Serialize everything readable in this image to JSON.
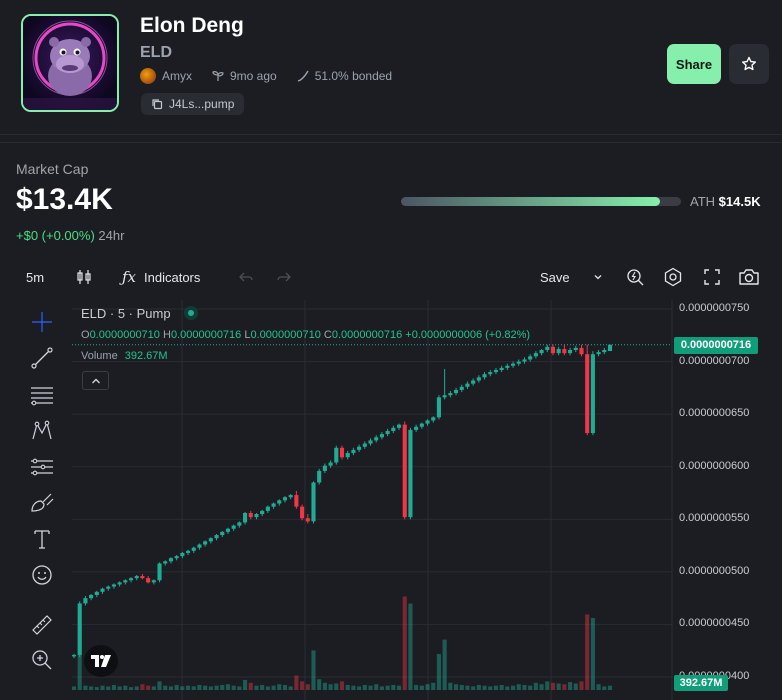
{
  "token": {
    "name": "Elon Deng",
    "ticker": "ELD",
    "creator": "Amyx",
    "age": "9mo ago",
    "bonded": "51.0% bonded",
    "contract_short": "J4Ls...pump"
  },
  "actions": {
    "share_label": "Share",
    "star_icon": "star-icon"
  },
  "market": {
    "label": "Market Cap",
    "value": "$13.4K",
    "change": "+$0 (+0.00%)",
    "period": "24hr",
    "ath_label": "ATH",
    "ath_value": "$14.5K",
    "ath_progress": 0.924
  },
  "toolbar": {
    "interval": "5m",
    "indicators_label": "Indicators",
    "save_label": "Save"
  },
  "chart_header": {
    "symbol": "ELD · 5 · Pump",
    "o_label": "O",
    "o": "0.0000000710",
    "h_label": "H",
    "h": "0.0000000716",
    "l_label": "L",
    "l": "0.0000000710",
    "c_label": "C",
    "c": "0.0000000716",
    "change": "+0.0000000006 (+0.82%)",
    "volume_label": "Volume",
    "volume": "392.67M"
  },
  "price_axis": [
    "0.0000000750",
    "0.0000000700",
    "0.0000000650",
    "0.0000000600",
    "0.0000000550",
    "0.0000000500",
    "0.0000000450",
    "0.0000000400"
  ],
  "last_price_tag": "0.0000000716",
  "volume_tag": "392.67M",
  "colors": {
    "up": "#22ab94",
    "down": "#f23645",
    "accent": "#86efac"
  },
  "chart_data": {
    "type": "candlestick",
    "ylim": [
      4e-08,
      7.6e-08
    ],
    "candles": [
      [
        4.2e-08,
        4.22e-08,
        4.18e-08,
        4.21e-08,
        "up"
      ],
      [
        4.21e-08,
        4.72e-08,
        4.19e-08,
        4.7e-08,
        "up"
      ],
      [
        4.7e-08,
        4.77e-08,
        4.68e-08,
        4.75e-08,
        "up"
      ],
      [
        4.75e-08,
        4.79e-08,
        4.73e-08,
        4.78e-08,
        "up"
      ],
      [
        4.78e-08,
        4.82e-08,
        4.76e-08,
        4.81e-08,
        "up"
      ],
      [
        4.81e-08,
        4.85e-08,
        4.79e-08,
        4.84e-08,
        "up"
      ],
      [
        4.84e-08,
        4.87e-08,
        4.82e-08,
        4.86e-08,
        "up"
      ],
      [
        4.86e-08,
        4.89e-08,
        4.84e-08,
        4.88e-08,
        "up"
      ],
      [
        4.88e-08,
        4.91e-08,
        4.86e-08,
        4.9e-08,
        "up"
      ],
      [
        4.9e-08,
        4.93e-08,
        4.88e-08,
        4.92e-08,
        "up"
      ],
      [
        4.92e-08,
        4.95e-08,
        4.9e-08,
        4.94e-08,
        "up"
      ],
      [
        4.94e-08,
        4.97e-08,
        4.92e-08,
        4.96e-08,
        "up"
      ],
      [
        4.96e-08,
        4.98e-08,
        4.93e-08,
        4.94e-08,
        "down"
      ],
      [
        4.94e-08,
        4.96e-08,
        4.89e-08,
        4.9e-08,
        "down"
      ],
      [
        4.9e-08,
        4.93e-08,
        4.88e-08,
        4.92e-08,
        "up"
      ],
      [
        4.92e-08,
        5.09e-08,
        4.9e-08,
        5.08e-08,
        "up"
      ],
      [
        5.08e-08,
        5.11e-08,
        5.06e-08,
        5.1e-08,
        "up"
      ],
      [
        5.1e-08,
        5.14e-08,
        5.08e-08,
        5.13e-08,
        "up"
      ],
      [
        5.13e-08,
        5.16e-08,
        5.11e-08,
        5.15e-08,
        "up"
      ],
      [
        5.15e-08,
        5.19e-08,
        5.13e-08,
        5.18e-08,
        "up"
      ],
      [
        5.18e-08,
        5.21e-08,
        5.16e-08,
        5.2e-08,
        "up"
      ],
      [
        5.2e-08,
        5.24e-08,
        5.18e-08,
        5.23e-08,
        "up"
      ],
      [
        5.23e-08,
        5.27e-08,
        5.21e-08,
        5.26e-08,
        "up"
      ],
      [
        5.26e-08,
        5.3e-08,
        5.24e-08,
        5.29e-08,
        "up"
      ],
      [
        5.29e-08,
        5.33e-08,
        5.27e-08,
        5.32e-08,
        "up"
      ],
      [
        5.32e-08,
        5.36e-08,
        5.3e-08,
        5.35e-08,
        "up"
      ],
      [
        5.35e-08,
        5.39e-08,
        5.33e-08,
        5.38e-08,
        "up"
      ],
      [
        5.38e-08,
        5.42e-08,
        5.36e-08,
        5.41e-08,
        "up"
      ],
      [
        5.41e-08,
        5.45e-08,
        5.39e-08,
        5.44e-08,
        "up"
      ],
      [
        5.44e-08,
        5.48e-08,
        5.42e-08,
        5.47e-08,
        "up"
      ],
      [
        5.47e-08,
        5.57e-08,
        5.45e-08,
        5.56e-08,
        "up"
      ],
      [
        5.56e-08,
        5.58e-08,
        5.5e-08,
        5.52e-08,
        "down"
      ],
      [
        5.52e-08,
        5.56e-08,
        5.5e-08,
        5.55e-08,
        "up"
      ],
      [
        5.55e-08,
        5.59e-08,
        5.53e-08,
        5.58e-08,
        "up"
      ],
      [
        5.58e-08,
        5.63e-08,
        5.56e-08,
        5.62e-08,
        "up"
      ],
      [
        5.62e-08,
        5.66e-08,
        5.6e-08,
        5.65e-08,
        "up"
      ],
      [
        5.65e-08,
        5.69e-08,
        5.63e-08,
        5.68e-08,
        "up"
      ],
      [
        5.68e-08,
        5.72e-08,
        5.66e-08,
        5.71e-08,
        "up"
      ],
      [
        5.71e-08,
        5.74e-08,
        5.69e-08,
        5.73e-08,
        "up"
      ],
      [
        5.73e-08,
        5.77e-08,
        5.6e-08,
        5.62e-08,
        "down"
      ],
      [
        5.62e-08,
        5.64e-08,
        5.49e-08,
        5.51e-08,
        "down"
      ],
      [
        5.51e-08,
        5.55e-08,
        5.46e-08,
        5.48e-08,
        "down"
      ],
      [
        5.48e-08,
        5.86e-08,
        5.46e-08,
        5.85e-08,
        "up"
      ],
      [
        5.85e-08,
        5.98e-08,
        5.83e-08,
        5.96e-08,
        "up"
      ],
      [
        5.96e-08,
        6.03e-08,
        5.94e-08,
        6.01e-08,
        "up"
      ],
      [
        6.01e-08,
        6.06e-08,
        5.99e-08,
        6.04e-08,
        "up"
      ],
      [
        6.04e-08,
        6.2e-08,
        6.02e-08,
        6.18e-08,
        "up"
      ],
      [
        6.18e-08,
        6.2e-08,
        6.07e-08,
        6.09e-08,
        "down"
      ],
      [
        6.09e-08,
        6.15e-08,
        6.07e-08,
        6.13e-08,
        "up"
      ],
      [
        6.13e-08,
        6.18e-08,
        6.11e-08,
        6.16e-08,
        "up"
      ],
      [
        6.16e-08,
        6.21e-08,
        6.14e-08,
        6.19e-08,
        "up"
      ],
      [
        6.19e-08,
        6.24e-08,
        6.17e-08,
        6.22e-08,
        "up"
      ],
      [
        6.22e-08,
        6.27e-08,
        6.2e-08,
        6.25e-08,
        "up"
      ],
      [
        6.25e-08,
        6.3e-08,
        6.23e-08,
        6.28e-08,
        "up"
      ],
      [
        6.28e-08,
        6.33e-08,
        6.26e-08,
        6.31e-08,
        "up"
      ],
      [
        6.31e-08,
        6.36e-08,
        6.29e-08,
        6.34e-08,
        "up"
      ],
      [
        6.34e-08,
        6.39e-08,
        6.32e-08,
        6.37e-08,
        "up"
      ],
      [
        6.37e-08,
        6.41e-08,
        6.35e-08,
        6.4e-08,
        "up"
      ],
      [
        6.4e-08,
        6.43e-08,
        5.5e-08,
        5.52e-08,
        "down"
      ],
      [
        5.52e-08,
        6.37e-08,
        5.5e-08,
        6.35e-08,
        "up"
      ],
      [
        6.35e-08,
        6.4e-08,
        6.33e-08,
        6.38e-08,
        "up"
      ],
      [
        6.38e-08,
        6.42e-08,
        6.36e-08,
        6.41e-08,
        "up"
      ],
      [
        6.41e-08,
        6.45e-08,
        6.39e-08,
        6.44e-08,
        "up"
      ],
      [
        6.44e-08,
        6.48e-08,
        6.42e-08,
        6.47e-08,
        "up"
      ],
      [
        6.47e-08,
        6.68e-08,
        6.45e-08,
        6.66e-08,
        "up"
      ],
      [
        6.66e-08,
        6.93e-08,
        6.64e-08,
        6.68e-08,
        "up"
      ],
      [
        6.68e-08,
        6.72e-08,
        6.66e-08,
        6.7e-08,
        "up"
      ],
      [
        6.7e-08,
        6.75e-08,
        6.68e-08,
        6.73e-08,
        "up"
      ],
      [
        6.73e-08,
        6.78e-08,
        6.71e-08,
        6.76e-08,
        "up"
      ],
      [
        6.76e-08,
        6.81e-08,
        6.74e-08,
        6.79e-08,
        "up"
      ],
      [
        6.79e-08,
        6.84e-08,
        6.77e-08,
        6.82e-08,
        "up"
      ],
      [
        6.82e-08,
        6.87e-08,
        6.8e-08,
        6.85e-08,
        "up"
      ],
      [
        6.85e-08,
        6.9e-08,
        6.83e-08,
        6.88e-08,
        "up"
      ],
      [
        6.88e-08,
        6.92e-08,
        6.86e-08,
        6.9e-08,
        "up"
      ],
      [
        6.9e-08,
        6.94e-08,
        6.88e-08,
        6.92e-08,
        "up"
      ],
      [
        6.92e-08,
        6.96e-08,
        6.9e-08,
        6.94e-08,
        "up"
      ],
      [
        6.94e-08,
        6.98e-08,
        6.92e-08,
        6.96e-08,
        "up"
      ],
      [
        6.96e-08,
        7e-08,
        6.94e-08,
        6.98e-08,
        "up"
      ],
      [
        6.98e-08,
        7.02e-08,
        6.96e-08,
        7e-08,
        "up"
      ],
      [
        7e-08,
        7.04e-08,
        6.98e-08,
        7.02e-08,
        "up"
      ],
      [
        7.02e-08,
        7.07e-08,
        7e-08,
        7.05e-08,
        "up"
      ],
      [
        7.05e-08,
        7.1e-08,
        7.03e-08,
        7.08e-08,
        "up"
      ],
      [
        7.08e-08,
        7.12e-08,
        7.06e-08,
        7.11e-08,
        "up"
      ],
      [
        7.11e-08,
        7.16e-08,
        7.09e-08,
        7.14e-08,
        "up"
      ],
      [
        7.14e-08,
        7.16e-08,
        7.06e-08,
        7.08e-08,
        "down"
      ],
      [
        7.08e-08,
        7.14e-08,
        7.06e-08,
        7.12e-08,
        "up"
      ],
      [
        7.12e-08,
        7.16e-08,
        7.06e-08,
        7.08e-08,
        "down"
      ],
      [
        7.08e-08,
        7.13e-08,
        7.06e-08,
        7.11e-08,
        "up"
      ],
      [
        7.11e-08,
        7.15e-08,
        7.09e-08,
        7.13e-08,
        "up"
      ],
      [
        7.13e-08,
        7.16e-08,
        7.05e-08,
        7.07e-08,
        "down"
      ],
      [
        7.07e-08,
        7.16e-08,
        6.3e-08,
        6.32e-08,
        "down"
      ],
      [
        6.32e-08,
        7.1e-08,
        6.3e-08,
        7.07e-08,
        "up"
      ],
      [
        7.07e-08,
        7.11e-08,
        7.05e-08,
        7.09e-08,
        "up"
      ],
      [
        7.09e-08,
        7.13e-08,
        7.07e-08,
        7.11e-08,
        "up"
      ],
      [
        7.1e-08,
        7.16e-08,
        7.1e-08,
        7.16e-08,
        "up"
      ]
    ],
    "volumes": [
      0.05,
      0.9,
      0.06,
      0.05,
      0.04,
      0.06,
      0.05,
      0.07,
      0.05,
      0.06,
      0.04,
      0.05,
      0.08,
      0.06,
      0.05,
      0.12,
      0.06,
      0.05,
      0.07,
      0.05,
      0.06,
      0.05,
      0.07,
      0.06,
      0.05,
      0.06,
      0.07,
      0.08,
      0.06,
      0.05,
      0.14,
      0.1,
      0.06,
      0.07,
      0.05,
      0.06,
      0.08,
      0.07,
      0.05,
      0.2,
      0.12,
      0.08,
      0.55,
      0.15,
      0.1,
      0.08,
      0.09,
      0.12,
      0.07,
      0.06,
      0.05,
      0.07,
      0.06,
      0.08,
      0.05,
      0.06,
      0.07,
      0.06,
      1.3,
      1.2,
      0.07,
      0.06,
      0.08,
      0.1,
      0.5,
      0.7,
      0.1,
      0.08,
      0.07,
      0.06,
      0.05,
      0.07,
      0.06,
      0.05,
      0.06,
      0.07,
      0.05,
      0.06,
      0.08,
      0.07,
      0.06,
      0.1,
      0.08,
      0.12,
      0.1,
      0.09,
      0.08,
      0.11,
      0.09,
      0.12,
      1.05,
      1.0,
      0.08,
      0.05,
      0.06
    ]
  }
}
